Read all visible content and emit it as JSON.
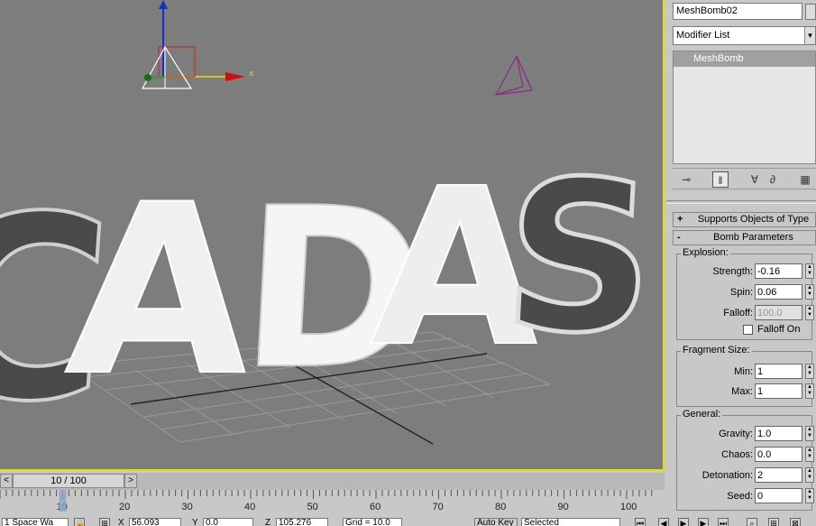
{
  "viewport": {
    "scene_text": "CADAS",
    "gizmo_axis_x": "x"
  },
  "command_panel": {
    "object_name": "MeshBomb02",
    "modifier_list_label": "Modifier List",
    "modifier_list_arrow": "▼",
    "stack_item": "MeshBomb",
    "tools": [
      "pin-stack-icon",
      "show-end-result-icon",
      "make-unique-icon",
      "remove-modifier-icon",
      "configure-modifier-sets-icon"
    ]
  },
  "rollouts": {
    "supports": {
      "sign": "+",
      "title": "Supports Objects of Type"
    },
    "bomb": {
      "sign": "-",
      "title": "Bomb Parameters"
    }
  },
  "explosion": {
    "label": "Explosion:",
    "strength_label": "Strength:",
    "strength_value": "-0.16",
    "spin_label": "Spin:",
    "spin_value": "0.06",
    "falloff_label": "Falloff:",
    "falloff_value": "100.0",
    "falloff_on_label": "Falloff On",
    "falloff_on_checked": false
  },
  "fragment": {
    "label": "Fragment Size:",
    "min_label": "Min:",
    "min_value": "1",
    "max_label": "Max:",
    "max_value": "1"
  },
  "general": {
    "label": "General:",
    "gravity_label": "Gravity:",
    "gravity_value": "1.0",
    "chaos_label": "Chaos:",
    "chaos_value": "0.0",
    "detonation_label": "Detonation:",
    "detonation_value": "2",
    "seed_label": "Seed:",
    "seed_value": "0"
  },
  "time_slider": {
    "prev": "<",
    "next": ">",
    "label": "10 / 100",
    "current_frame": 10,
    "total_frames": 100
  },
  "trackbar": {
    "ticks": [
      "10",
      "20",
      "30",
      "40",
      "50",
      "60",
      "70",
      "80",
      "90",
      "100"
    ]
  },
  "status_bar": {
    "selection_count": "1 Space Wa",
    "x_label": "X",
    "x_value": "56.093",
    "y_label": "Y",
    "y_value": "0.0",
    "z_label": "Z",
    "z_value": "105.276",
    "grid": "Grid = 10.0",
    "auto_key": "Auto Key",
    "selected": "Selected"
  },
  "colors": {
    "viewport_bg": "#7d7d7d",
    "active_border": "#e8e000",
    "panel_bg": "#c8c8c8"
  }
}
